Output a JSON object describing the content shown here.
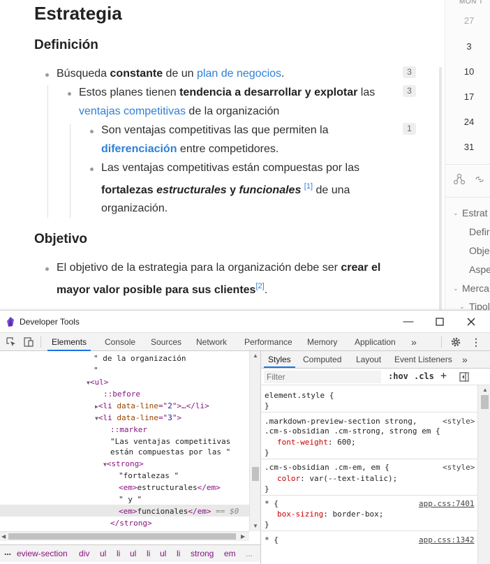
{
  "note": {
    "title": "Estrategia",
    "section1": "Definición",
    "item1": {
      "t1": "Búsqueda ",
      "b1": "constante",
      "t2": " de un ",
      "link": "plan de negocios",
      "t3": ".",
      "count": "3"
    },
    "item2": {
      "t1": "Estos planes tienen ",
      "b1": "tendencia a desarrollar y explotar",
      "t2": " las",
      "link": "ventajas competitivas",
      "t3": " de la organización",
      "count": "3"
    },
    "item3": {
      "t1": "Son ventajas competitivas las que permiten la",
      "link": "diferenciación",
      "t2": " entre competidores.",
      "count": "1"
    },
    "item4": {
      "t1": "Las ventajas competitivas están compuestas por las",
      "b1": "fortalezas ",
      "bi1": "estructurales",
      "b2": " y ",
      "bi2": "funcionales",
      "ref": "[1]",
      "t2": " de una",
      "t3": "organización."
    },
    "section2": "Objetivo",
    "item5": {
      "t1": "El objetivo de la estrategia para la organización debe ser ",
      "b1": "crear el",
      "b2": "mayor valor posible para sus clientes",
      "ref": "[2]",
      "t2": "."
    }
  },
  "calendar": {
    "header": "MON T",
    "days": [
      "27",
      "3",
      "10",
      "17",
      "24",
      "31"
    ]
  },
  "outline": {
    "items": [
      "Estrat",
      "Defir",
      "Obje",
      "Aspe",
      "Merca",
      "Tipol"
    ]
  },
  "devtools": {
    "title": "Developer Tools",
    "tabs": [
      "Elements",
      "Console",
      "Sources",
      "Network",
      "Performance",
      "Memory",
      "Application"
    ],
    "more": "»",
    "elements": {
      "l1": "\" de la organización",
      "l2": "\"",
      "l3": "<ul>",
      "l4": "::before",
      "l5a": "<li ",
      "l5b": "data-line",
      "l5c": "=\"",
      "l5d": "2",
      "l5e": "\">…</li>",
      "l6a": "<li ",
      "l6b": "data-line",
      "l6c": "=\"",
      "l6d": "3",
      "l6e": "\">",
      "l7": "::marker",
      "l8": "\"Las ventajas competitivas",
      "l9": "están compuestas por las \"",
      "l10": "<strong>",
      "l11": "\"fortalezas \"",
      "l12a": "<em>",
      "l12b": "estructurales",
      "l12c": "</em>",
      "l13": "\" y \"",
      "l14a": "<em>",
      "l14b": "funcionales",
      "l14c": "</em>",
      "l14d": " == $0",
      "l15": "</strong>"
    },
    "breadcrumbs": [
      "...",
      "eview-section",
      "div",
      "ul",
      "li",
      "ul",
      "li",
      "ul",
      "li",
      "strong",
      "em",
      "..."
    ],
    "styles": {
      "tabs": [
        "Styles",
        "Computed",
        "Layout",
        "Event Listeners"
      ],
      "more": "»",
      "filter_placeholder": "Filter",
      "hov": ":hov",
      "cls": ".cls",
      "plus": "+",
      "r1_sel": "element.style {",
      "r1_close": "}",
      "r2_sel1": ".markdown-preview-section strong,",
      "r2_src": "<style>",
      "r2_sel2": ".cm-s-obsidian .cm-strong, strong em {",
      "r2_prop": "font-weight",
      "r2_val": ": 600;",
      "r2_close": "}",
      "r3_sel": ".cm-s-obsidian .cm-em, em {",
      "r3_src": "<style>",
      "r3_prop": "color",
      "r3_val": ": var(--text-italic);",
      "r3_close": "}",
      "r4_sel": "* {",
      "r4_src": "app.css:7401",
      "r4_prop": "box-sizing",
      "r4_val": ": border-box;",
      "r4_close": "}",
      "r5_sel": "* {",
      "r5_src": "app.css:1342"
    }
  }
}
